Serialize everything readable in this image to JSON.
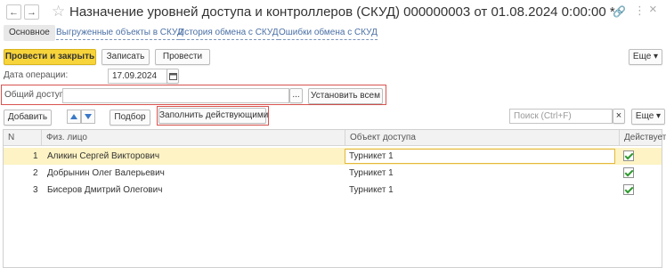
{
  "window": {
    "title": "Назначение уровней доступа и контроллеров (СКУД) 000000003 от 01.08.2024 0:00:00 *",
    "back_glyph": "←",
    "forward_glyph": "→",
    "star_glyph": "☆",
    "link_glyph": "🔗",
    "more_glyph": "⋮",
    "close_glyph": "×"
  },
  "tabs": [
    {
      "label": "Основное",
      "active": true
    },
    {
      "label": "Выгруженные объекты в СКУД"
    },
    {
      "label": "История обмена с СКУД"
    },
    {
      "label": "Ошибки обмена с СКУД"
    }
  ],
  "toolbar": {
    "post_close_label": "Провести и закрыть",
    "write_label": "Записать",
    "post_label": "Провести",
    "more_label": "Еще ▾"
  },
  "form": {
    "date_label": "Дата операции:",
    "date_value": "17.09.2024",
    "general_access_label": "Общий доступ:",
    "general_access_value": "",
    "ellipsis_label": "...",
    "set_all_label": "Установить всем"
  },
  "table_toolbar": {
    "add_label": "Добавить",
    "pick_label": "Подбор",
    "fill_active_label": "Заполнить действующими",
    "search_placeholder": "Поиск (Ctrl+F)",
    "clear_glyph": "×",
    "more_label": "Еще ▾"
  },
  "table": {
    "columns": [
      "N",
      "Физ. лицо",
      "Объект доступа",
      "Действует"
    ],
    "rows": [
      {
        "n": "1",
        "person": "Аликин Сергей Викторович",
        "object": "Турникет 1",
        "active": true,
        "selected": true
      },
      {
        "n": "2",
        "person": "Добрынин Олег Валерьевич",
        "object": "Турникет 1",
        "active": true
      },
      {
        "n": "3",
        "person": "Бисеров Дмитрий Олегович",
        "object": "Турникет 1",
        "active": true
      }
    ]
  },
  "colors": {
    "primary_button": "#f7d43a",
    "selected_row": "#fdf3c4",
    "highlight_border": "#d9534f",
    "link": "#4a6fa5"
  }
}
